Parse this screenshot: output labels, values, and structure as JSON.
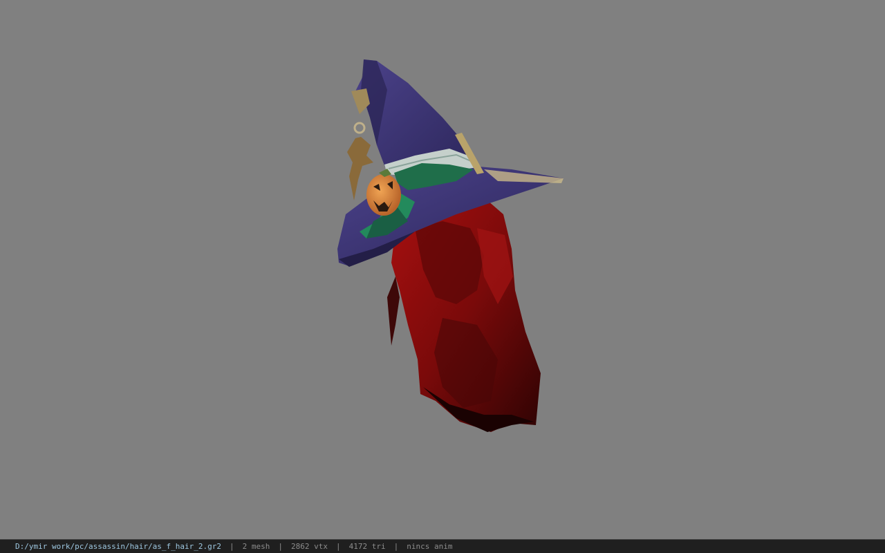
{
  "viewer": {
    "background_color": "#808080",
    "model_subject": "witch-hat-with-red-hair"
  },
  "status": {
    "file_path": "D:/ymir work/pc/assassin/hair/as_f_hair_2.gr2",
    "separator": "|",
    "mesh_count": "2 mesh",
    "vertex_count": "2862 vtx",
    "triangle_count": "4172 tri",
    "anim_status": "nincs anim"
  },
  "colors": {
    "hat": "#3d3573",
    "hat_dark": "#2a2450",
    "hair": "#8a0c0c",
    "hair_dark": "#3a0505",
    "pumpkin": "#d98a3a",
    "band": "#1f6e4a",
    "lace": "#c9d3cf",
    "statusbar": "#1f1f1f"
  }
}
